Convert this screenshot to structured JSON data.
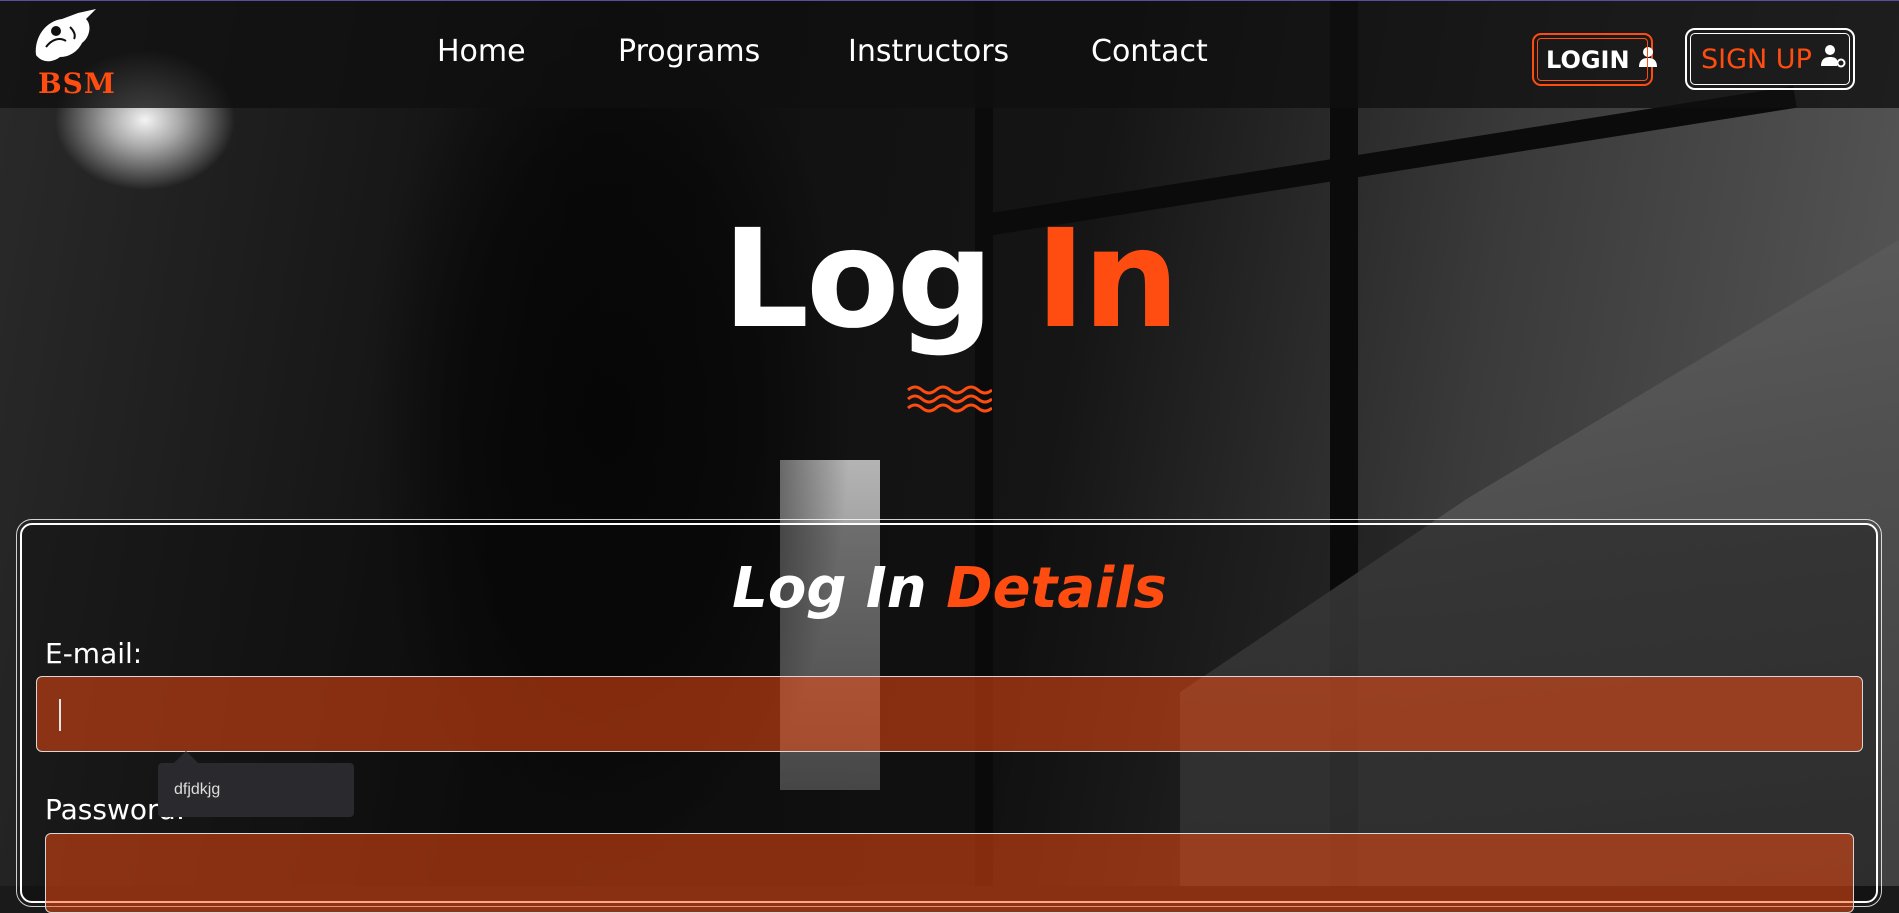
{
  "brand": {
    "name": "BSM",
    "logo_icon": "warrior-logo-icon",
    "accent_color": "#ff4d11"
  },
  "nav": {
    "items": [
      {
        "label": "Home"
      },
      {
        "label": "Programs"
      },
      {
        "label": "Instructors"
      },
      {
        "label": "Contact"
      }
    ],
    "login": {
      "label": "LOGIN",
      "icon": "user-icon"
    },
    "signup": {
      "label": "SIGN UP",
      "icon": "user-gear-icon"
    }
  },
  "hero": {
    "title_main": "Log ",
    "title_accent": "In",
    "divider_icon": "waves-icon"
  },
  "form": {
    "title_main": "Log In ",
    "title_accent": "Details",
    "email": {
      "label": "E-mail:",
      "value": ""
    },
    "autofill_suggestion": "dfjdkjg",
    "password": {
      "label": "Password:",
      "value": ""
    }
  }
}
